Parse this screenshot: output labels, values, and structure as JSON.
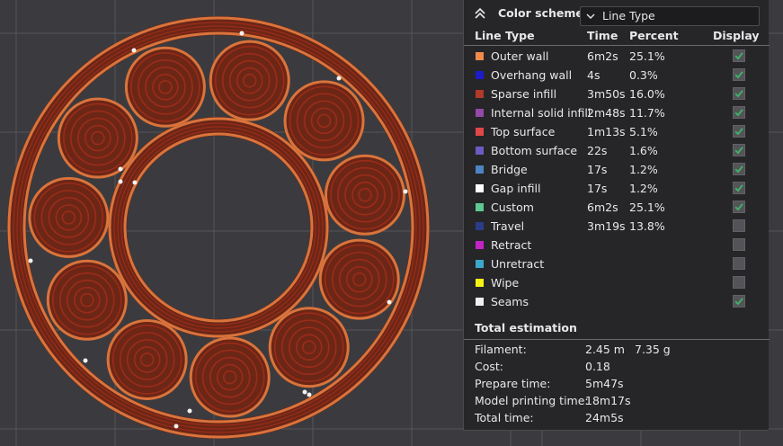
{
  "legend": {
    "title": "Color scheme",
    "scheme_value": "Line Type",
    "columns": {
      "type": "Line Type",
      "time": "Time",
      "percent": "Percent",
      "display": "Display"
    },
    "rows": [
      {
        "name": "Outer wall",
        "time": "6m2s",
        "percent": "25.1%",
        "color": "#f08a4b",
        "display": true
      },
      {
        "name": "Overhang wall",
        "time": "4s",
        "percent": "0.3%",
        "color": "#1c1cc8",
        "display": true
      },
      {
        "name": "Sparse infill",
        "time": "3m50s",
        "percent": "16.0%",
        "color": "#b03a2a",
        "display": true
      },
      {
        "name": "Internal solid infill",
        "time": "2m48s",
        "percent": "11.7%",
        "color": "#9448a8",
        "display": true
      },
      {
        "name": "Top surface",
        "time": "1m13s",
        "percent": "5.1%",
        "color": "#e04848",
        "display": true
      },
      {
        "name": "Bottom surface",
        "time": "22s",
        "percent": "1.6%",
        "color": "#6a5cc0",
        "display": true
      },
      {
        "name": "Bridge",
        "time": "17s",
        "percent": "1.2%",
        "color": "#4f84c4",
        "display": true
      },
      {
        "name": "Gap infill",
        "time": "17s",
        "percent": "1.2%",
        "color": "#ffffff",
        "display": true
      },
      {
        "name": "Custom",
        "time": "6m2s",
        "percent": "25.1%",
        "color": "#5ec890",
        "display": true
      },
      {
        "name": "Travel",
        "time": "3m19s",
        "percent": "13.8%",
        "color": "#2c3c88",
        "display": false
      },
      {
        "name": "Retract",
        "time": "",
        "percent": "",
        "color": "#c424c4",
        "display": false
      },
      {
        "name": "Unretract",
        "time": "",
        "percent": "",
        "color": "#3aa8c8",
        "display": false
      },
      {
        "name": "Wipe",
        "time": "",
        "percent": "",
        "color": "#f4f414",
        "display": false
      },
      {
        "name": "Seams",
        "time": "",
        "percent": "",
        "color": "#f0f0f0",
        "display": true
      }
    ]
  },
  "estimation": {
    "title": "Total estimation",
    "rows": [
      {
        "label": "Filament:",
        "value": "2.45 m",
        "value2": "7.35 g"
      },
      {
        "label": "Cost:",
        "value": "0.18",
        "value2": ""
      },
      {
        "label": "Prepare time:",
        "value": "5m47s",
        "value2": ""
      },
      {
        "label": "Model printing time:",
        "value": "18m17s",
        "value2": ""
      },
      {
        "label": "Total time:",
        "value": "24m5s",
        "value2": ""
      }
    ]
  },
  "colors": {
    "background": "#3b3b3f",
    "grid": "#55555a",
    "outer_wall": "#d9743c",
    "inner_line": "#9a2c1a",
    "fill": "#6c2616",
    "check": "#3fb56a"
  }
}
